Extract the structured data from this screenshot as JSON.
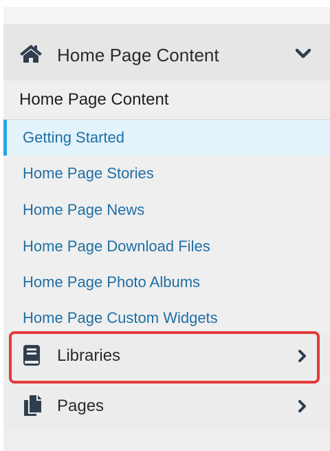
{
  "header": {
    "title": "Home Page Content",
    "icon": "home-icon",
    "chevron": "chevron-down-icon"
  },
  "subheading": "Home Page Content",
  "links": [
    {
      "label": "Getting Started",
      "active": true
    },
    {
      "label": "Home Page Stories",
      "active": false
    },
    {
      "label": "Home Page News",
      "active": false
    },
    {
      "label": "Home Page Download Files",
      "active": false
    },
    {
      "label": "Home Page Photo Albums",
      "active": false
    },
    {
      "label": "Home Page Custom Widgets",
      "active": false
    }
  ],
  "sections": [
    {
      "label": "Libraries",
      "icon": "book-icon",
      "chevron": "chevron-right-icon",
      "highlighted": true
    },
    {
      "label": "Pages",
      "icon": "copy-pages-icon",
      "chevron": "chevron-right-icon",
      "highlighted": false
    }
  ],
  "colors": {
    "link": "#1f6fa4",
    "active_bg": "#e3f3fb",
    "active_bar": "#27a6e0",
    "icon": "#2f3f4f",
    "highlight": "#e53939"
  }
}
